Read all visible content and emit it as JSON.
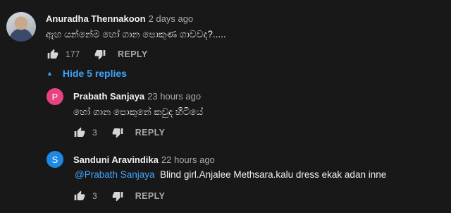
{
  "comment": {
    "author": "Anuradha Thennakoon",
    "time": "2 days ago",
    "text": "ඇහ යන්නේම හෝ ගාන පොකුණ ගාවවද?.....",
    "likes": "177",
    "reply_label": "REPLY",
    "toggle_label": "Hide 5 replies"
  },
  "replies": [
    {
      "avatar_letter": "P",
      "avatar_color": "#e8437f",
      "author": "Prabath Sanjaya",
      "time": "23 hours ago",
      "mention": "",
      "text": "හෝ ගාන පොකුනේ කවුද හිටියේ",
      "likes": "3",
      "reply_label": "REPLY"
    },
    {
      "avatar_letter": "S",
      "avatar_color": "#1e88e5",
      "author": "Sanduni Aravindika",
      "time": "22 hours ago",
      "mention": "@Prabath Sanjaya",
      "text": "Blind girl.Anjalee Methsara.kalu dress ekak adan inne",
      "likes": "3",
      "reply_label": "REPLY"
    }
  ],
  "icons": {
    "like": "thumbs-up-icon",
    "dislike": "thumbs-down-icon",
    "toggle": "caret-up-icon"
  }
}
